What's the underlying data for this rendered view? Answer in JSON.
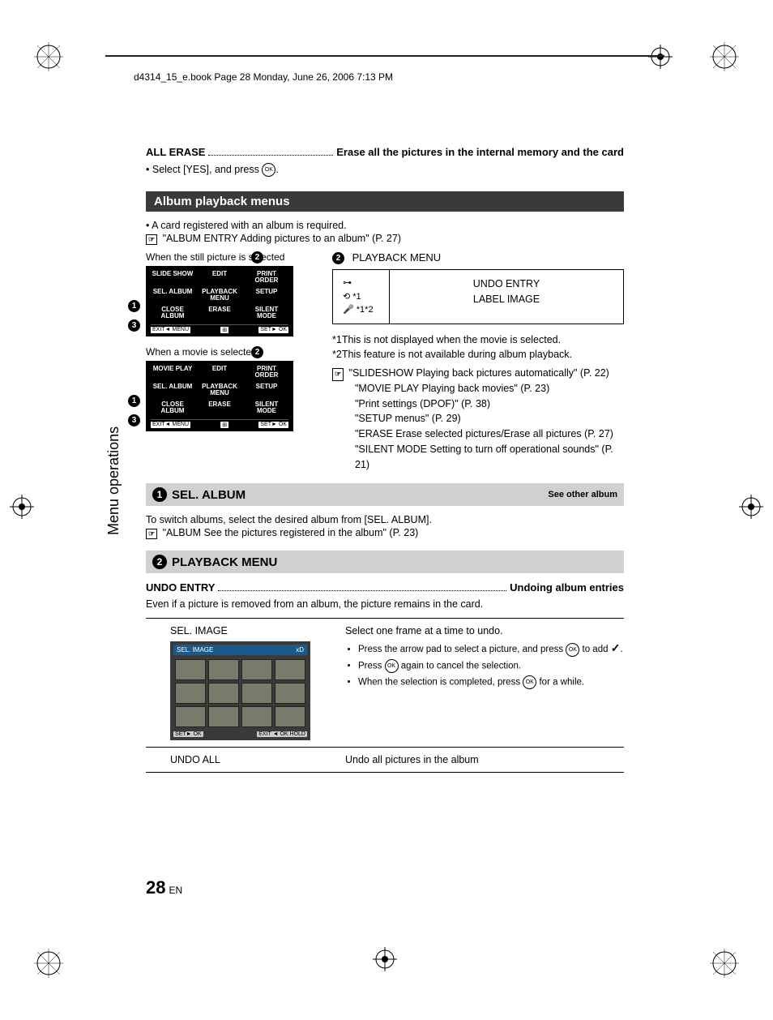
{
  "header": "d4314_15_e.book  Page 28  Monday, June 26, 2006  7:13 PM",
  "all_erase": {
    "label": "ALL ERASE",
    "desc": "Erase all the pictures in the internal memory and the card",
    "step": "Select [YES], and press "
  },
  "section1": "Album playback menus",
  "s1_note1": "A card registered with an album is required.",
  "s1_ref1": "\"ALBUM ENTRY Adding pictures to an album\" (P. 27)",
  "caption_still": "When the still picture is selected",
  "caption_movie": "When a movie is selected",
  "diagram_still": {
    "cells": [
      "SLIDE SHOW",
      "EDIT",
      "PRINT ORDER",
      "SEL. ALBUM",
      "PLAYBACK MENU",
      "SETUP",
      "CLOSE ALBUM",
      "ERASE",
      "SILENT MODE"
    ],
    "footer_left": "EXIT◄ MENU",
    "footer_right": "SET► OK"
  },
  "diagram_movie": {
    "cells": [
      "MOVIE PLAY",
      "EDIT",
      "PRINT ORDER",
      "SEL. ALBUM",
      "PLAYBACK MENU",
      "SETUP",
      "CLOSE ALBUM",
      "ERASE",
      "SILENT MODE"
    ],
    "footer_left": "EXIT◄ MENU",
    "footer_right": "SET► OK"
  },
  "pb_title": "PLAYBACK MENU",
  "pb_box": {
    "left_sup1": "*1",
    "left_sup2": "*1*2",
    "right1": "UNDO ENTRY",
    "right2": "LABEL IMAGE"
  },
  "notes": {
    "n1": "*1This is not displayed when the movie is selected.",
    "n2": "*2This feature is not available during album playback."
  },
  "refs": [
    "\"SLIDESHOW Playing back pictures automatically\" (P. 22)",
    "\"MOVIE PLAY Playing back movies\" (P. 23)",
    "\"Print settings (DPOF)\" (P. 38)",
    "\"SETUP menus\" (P. 29)",
    "\"ERASE Erase selected pictures/Erase all pictures (P. 27)",
    "\"SILENT MODE Setting to turn off operational sounds\" (P. 21)"
  ],
  "sel_album": {
    "num": "1",
    "title": "SEL. ALBUM",
    "sub": "See other album",
    "line1": "To switch albums, select the desired album from [SEL. ALBUM].",
    "ref": "\"ALBUM See the pictures registered in the album\" (P. 23)"
  },
  "playback_menu_section": {
    "num": "2",
    "title": "PLAYBACK MENU"
  },
  "undo_entry": {
    "label": "UNDO ENTRY",
    "desc": "Undoing album entries",
    "note": "Even if a picture is removed from an album, the picture remains in the card."
  },
  "table": {
    "r1_c1": "SEL. IMAGE",
    "r1_c2": "Select one frame at a time to undo.",
    "r1_b1a": "Press the arrow pad to select a picture, and press ",
    "r1_b1b": " to add ",
    "r1_b2a": "Press ",
    "r1_b2b": " again to cancel the selection.",
    "r1_b3a": "When the selection is completed, press ",
    "r1_b3b": " for a while.",
    "r2_c1": "UNDO ALL",
    "r2_c2": "Undo all pictures in the album"
  },
  "lcd": {
    "title": "SEL. IMAGE",
    "card": "xD",
    "f1": "SET► OK",
    "f2": "EXIT ◄ OK HOLD"
  },
  "side_tab": "Menu operations",
  "page_number": "28",
  "page_lang": "EN",
  "pointer_label": "☞"
}
